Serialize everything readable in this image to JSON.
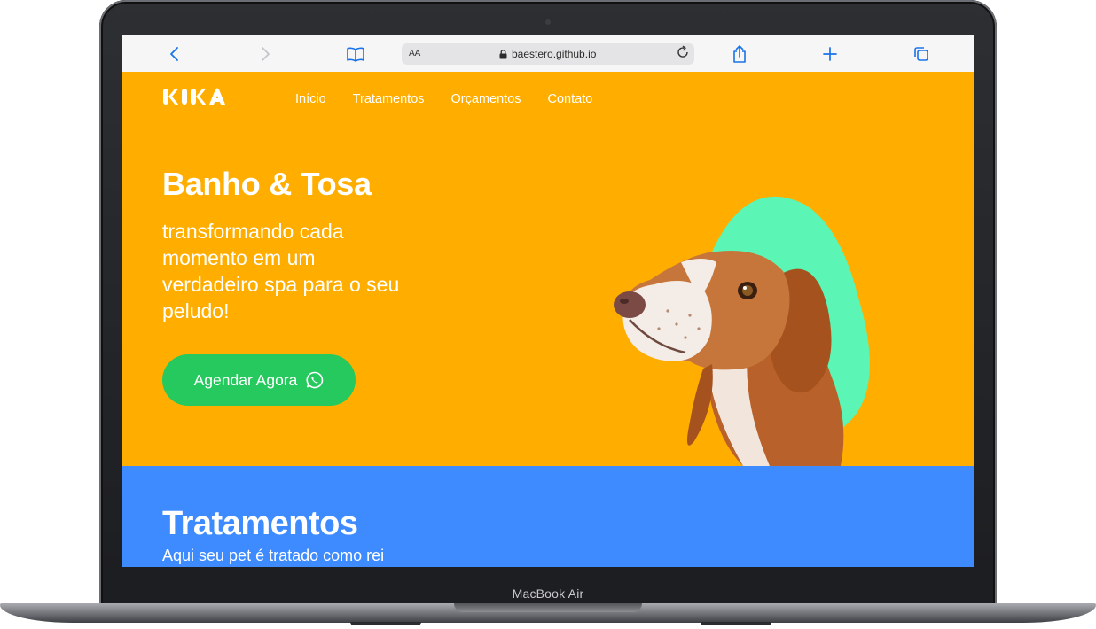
{
  "device": {
    "label": "MacBook Air"
  },
  "browser": {
    "text_size_label": "AA",
    "url": "baestero.github.io",
    "icons": [
      "back-icon",
      "forward-icon",
      "bookmarks-icon",
      "lock-icon",
      "reload-icon",
      "share-icon",
      "new-tab-icon",
      "tabs-icon"
    ]
  },
  "site": {
    "logo": "KIKA",
    "nav": [
      "Início",
      "Tratamentos",
      "Orçamentos",
      "Contato"
    ],
    "hero": {
      "title": "Banho & Tosa",
      "subtitle": "transformando cada momento em um verdadeiro spa para o seu peludo!",
      "cta_label": "Agendar Agora",
      "cta_icon": "whatsapp-icon"
    },
    "treatments": {
      "title": "Tratamentos",
      "subtitle": "Aqui seu pet é tratado como rei"
    }
  },
  "colors": {
    "hero_bg": "#ffae00",
    "cta_bg": "#26c95d",
    "accent_shape": "#5bf5b5",
    "section_bg": "#3d8bff",
    "browser_accent": "#1a73e8"
  }
}
